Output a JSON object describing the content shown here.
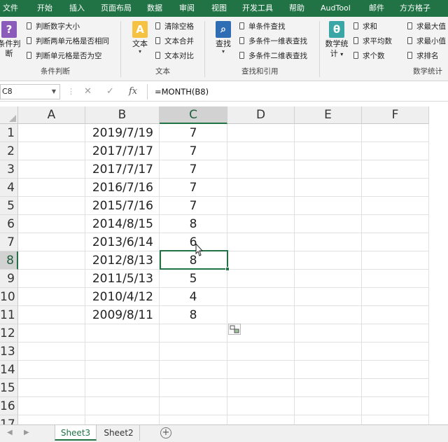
{
  "ribbon_tabs": [
    "文件",
    "开始",
    "插入",
    "页面布局",
    "数据",
    "审阅",
    "视图",
    "开发工具",
    "帮助",
    "AudTool",
    "邮件",
    "方方格子"
  ],
  "ribbon": {
    "cond_group": {
      "large_label_1": "条件判",
      "large_label_2": "断",
      "items": [
        "判断数字大小",
        "判断两单元格是否相同",
        "判断单元格是否为空"
      ],
      "group_label": "条件判断"
    },
    "text_group": {
      "large_label": "文本",
      "items": [
        "清除空格",
        "文本合并",
        "文本对比"
      ],
      "group_label": "文本"
    },
    "lookup_group": {
      "large_label": "查找",
      "items": [
        "单条件查找",
        "多条件一维表查找",
        "多条件二维表查找"
      ],
      "group_label": "查找和引用"
    },
    "stats_group": {
      "large_label_1": "数学统",
      "large_label_2": "计",
      "items_col1": [
        "求和",
        "求平均数",
        "求个数"
      ],
      "items_col2": [
        "求最大值",
        "求最小值",
        "求排名"
      ],
      "group_label": "数学统计"
    }
  },
  "formula_bar": {
    "name_box": "C8",
    "formula": "=MONTH(B8)"
  },
  "grid": {
    "columns": [
      "A",
      "B",
      "C",
      "D",
      "E",
      "F"
    ],
    "rows": [
      "1",
      "2",
      "3",
      "4",
      "5",
      "6",
      "7",
      "8",
      "9",
      "10",
      "11",
      "12",
      "13",
      "14",
      "15",
      "16",
      "17"
    ],
    "data": [
      {
        "b": "2019/7/19",
        "c": "7"
      },
      {
        "b": "2017/7/17",
        "c": "7"
      },
      {
        "b": "2017/7/17",
        "c": "7"
      },
      {
        "b": "2016/7/16",
        "c": "7"
      },
      {
        "b": "2015/7/16",
        "c": "7"
      },
      {
        "b": "2014/8/15",
        "c": "8"
      },
      {
        "b": "2013/6/14",
        "c": "6"
      },
      {
        "b": "2012/8/13",
        "c": "8"
      },
      {
        "b": "2011/5/13",
        "c": "5"
      },
      {
        "b": "2010/4/12",
        "c": "4"
      },
      {
        "b": "2009/8/11",
        "c": "8"
      }
    ],
    "selected_cell": "C8"
  },
  "sheet_tabs": [
    "Sheet3",
    "Sheet2"
  ],
  "active_sheet": "Sheet3",
  "colors": {
    "accent": "#217346",
    "gridline": "#e1e1e1",
    "header_bg": "#efefef"
  }
}
